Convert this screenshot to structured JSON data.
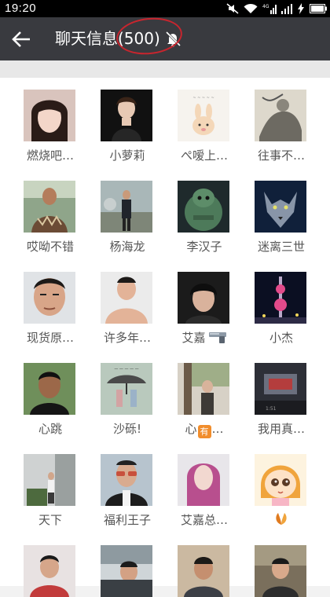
{
  "status_bar": {
    "time": "19:20",
    "network_label": "4G"
  },
  "header": {
    "title": "聊天信息",
    "count": "(500)"
  },
  "colors": {
    "header_bg": "#393a3f",
    "annotation": "#c8252e",
    "status_bg": "#000000"
  },
  "members": [
    {
      "name": "燃烧吧…",
      "avatar": "woman-selfie"
    },
    {
      "name": "小萝莉",
      "avatar": "woman-dark-dress"
    },
    {
      "name": "ぺ嗳上…",
      "avatar": "rabbit-cartoon"
    },
    {
      "name": "往事不…",
      "avatar": "ink-painting"
    },
    {
      "name": "哎呦不错",
      "avatar": "man-patterned-shirt"
    },
    {
      "name": "杨海龙",
      "avatar": "man-fountain"
    },
    {
      "name": "李汉子",
      "avatar": "green-robot"
    },
    {
      "name": "迷离三世",
      "avatar": "wolf"
    },
    {
      "name": "现货原…",
      "avatar": "man-closeup"
    },
    {
      "name": "许多年…",
      "avatar": "shirtless-man"
    },
    {
      "name": "艾嘉",
      "avatar": "young-man-dark",
      "suffix_icon": "pistol-icon"
    },
    {
      "name": "小杰",
      "avatar": "tower-night"
    },
    {
      "name": "心跳",
      "avatar": "man-green-bg"
    },
    {
      "name": "沙砾!",
      "avatar": "couple-umbrella"
    },
    {
      "name": "心",
      "badge": "有",
      "name_tail": "…",
      "avatar": "person-tree"
    },
    {
      "name": "我用真…",
      "avatar": "dark-room"
    },
    {
      "name": "天下",
      "avatar": "man-building"
    },
    {
      "name": "福利王子",
      "avatar": "man-sunglasses"
    },
    {
      "name": "艾嘉总…",
      "avatar": "pink-hair-woman"
    },
    {
      "name": "",
      "suffix_icon": "leaf-icon",
      "avatar": "cartoon-girl"
    },
    {
      "name": "",
      "avatar": "man-red"
    },
    {
      "name": "",
      "avatar": "car-driver"
    },
    {
      "name": "",
      "avatar": "man-office"
    },
    {
      "name": "",
      "avatar": "man-street"
    }
  ]
}
